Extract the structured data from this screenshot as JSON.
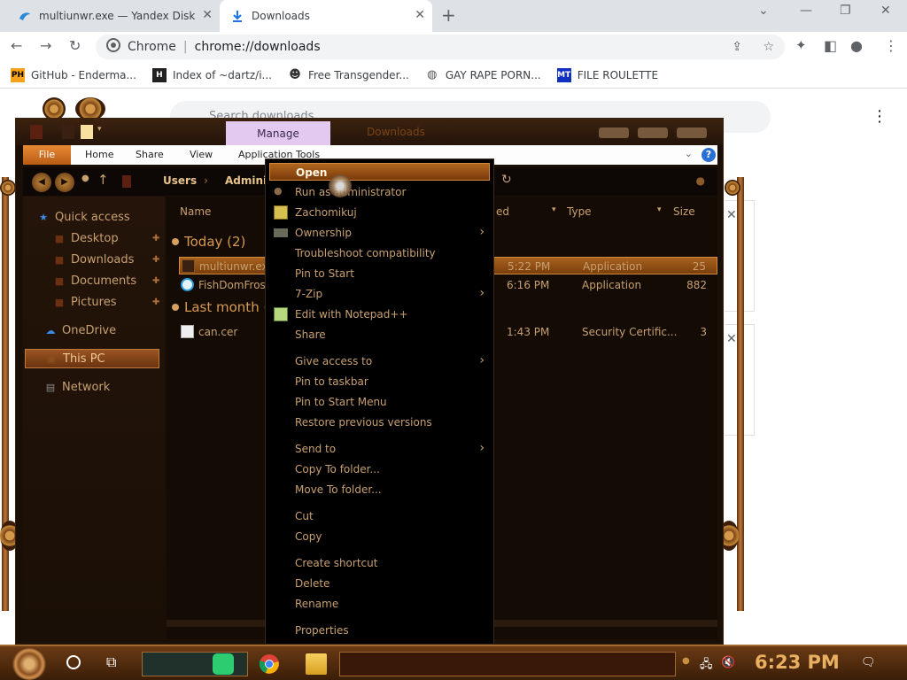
{
  "browser": {
    "tabs": [
      {
        "label": "multiunwr.exe — Yandex Disk",
        "active": false
      },
      {
        "label": "Downloads",
        "active": true
      }
    ],
    "omnibox": {
      "scheme_label": "Chrome",
      "url": "chrome://downloads"
    },
    "bookmarks": [
      {
        "label": "GitHub - Enderma...",
        "icon": "PH"
      },
      {
        "label": "Index of ~dartz/i...",
        "icon": "H"
      },
      {
        "label": "Free Transgender...",
        "icon": "mask"
      },
      {
        "label": "GAY RAPE PORN...",
        "icon": "globe"
      },
      {
        "label": "FILE ROULETTE",
        "icon": "MT"
      }
    ],
    "downloads_page": {
      "search_placeholder": "Search downloads"
    }
  },
  "explorer": {
    "manage_tab": "Manage",
    "title": "Downloads",
    "ribbon_tabs": [
      "File",
      "Home",
      "Share",
      "View",
      "Application Tools"
    ],
    "breadcrumb": [
      "Users",
      "Adminis"
    ],
    "sidebar": [
      {
        "label": "Quick access",
        "icon": "star"
      },
      {
        "label": "Desktop",
        "icon": "folder"
      },
      {
        "label": "Downloads",
        "icon": "folder"
      },
      {
        "label": "Documents",
        "icon": "folder"
      },
      {
        "label": "Pictures",
        "icon": "folder"
      },
      {
        "label": "OneDrive",
        "icon": "cloud"
      },
      {
        "label": "This PC",
        "icon": "pc"
      },
      {
        "label": "Network",
        "icon": "network"
      }
    ],
    "columns": {
      "name": "Name",
      "date": "ed",
      "type": "Type",
      "size": "Size"
    },
    "groups": [
      {
        "label": "Today (2)",
        "files": [
          {
            "name": "multiunwr.exe",
            "date": "5:22 PM",
            "type": "Application",
            "size": "25",
            "selected": true
          },
          {
            "name": "FishDomFrost",
            "date": "6:16 PM",
            "type": "Application",
            "size": "882",
            "selected": false
          }
        ]
      },
      {
        "label": "Last month (1",
        "files": [
          {
            "name": "can.cer",
            "date": "1:43 PM",
            "type": "Security Certific...",
            "size": "3",
            "selected": false
          }
        ]
      }
    ]
  },
  "context_menu": [
    {
      "label": "Open",
      "highlighted": true,
      "submenu": false
    },
    {
      "label": "Run as administrator",
      "submenu": false
    },
    {
      "label": "Zachomikuj",
      "submenu": false
    },
    {
      "label": "Ownership",
      "submenu": true
    },
    {
      "label": "Troubleshoot compatibility",
      "submenu": false
    },
    {
      "label": "Pin to Start",
      "submenu": false
    },
    {
      "label": "7-Zip",
      "submenu": true
    },
    {
      "label": "Edit with Notepad++",
      "submenu": false
    },
    {
      "label": "Share",
      "submenu": false
    },
    {
      "label": "Give access to",
      "submenu": true
    },
    {
      "label": "Pin to taskbar",
      "submenu": false
    },
    {
      "label": "Pin to Start Menu",
      "submenu": false
    },
    {
      "label": "Restore previous versions",
      "submenu": false
    },
    {
      "label": "Send to",
      "submenu": true
    },
    {
      "label": "Copy To folder...",
      "submenu": false
    },
    {
      "label": "Move To folder...",
      "submenu": false
    },
    {
      "label": "Cut",
      "submenu": false
    },
    {
      "label": "Copy",
      "submenu": false
    },
    {
      "label": "Create shortcut",
      "submenu": false
    },
    {
      "label": "Delete",
      "submenu": false
    },
    {
      "label": "Rename",
      "submenu": false
    },
    {
      "label": "Properties",
      "submenu": false
    }
  ],
  "taskbar": {
    "clock": "6:23 PM"
  },
  "colors": {
    "accent": "#b0661f",
    "manage_tab": "#e3c8f0",
    "clock": "#e8b060"
  }
}
